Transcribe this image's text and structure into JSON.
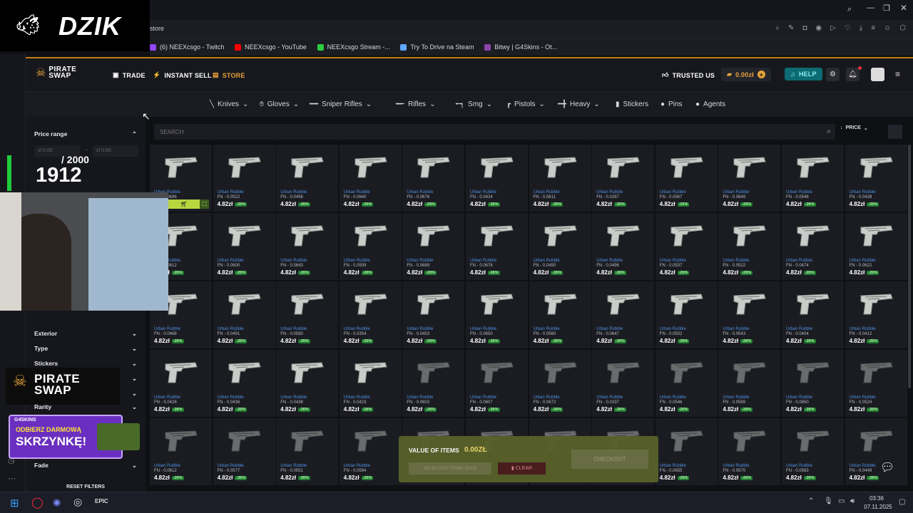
{
  "overlay": {
    "stream_logo": "DZIK",
    "counter_top": "/ 2000",
    "counter_value": "1912",
    "promo_logo_line1": "PIRATE",
    "promo_logo_line2": "SWAP",
    "promo_brand": "G4SKINS",
    "promo_text_top": "ODBIERZ DARMOWĄ",
    "promo_text_bottom": "SKRZYNKĘ!"
  },
  "browser": {
    "address_text": "store",
    "bookmarks": [
      {
        "label": "(6) NEEXcsgo - Twitch",
        "color": "#9146ff"
      },
      {
        "label": "NEEXcsgo - YouTube",
        "color": "#ff0000"
      },
      {
        "label": "NEEXcsgo Stream -...",
        "color": "#2ecc40"
      },
      {
        "label": "Try To Drive na Steam",
        "color": "#5fa8ff"
      },
      {
        "label": "Bitwy | G4Skins - Ot...",
        "color": "#8e44ad"
      }
    ]
  },
  "app": {
    "logo_line1": "PIRATE",
    "logo_line2": "SWAP",
    "nav": [
      "TRADE",
      "INSTANT SELL",
      "STORE"
    ],
    "active_nav": "STORE",
    "trusted": "TRUSTED US",
    "balance": "0.00zł",
    "help": "HELP",
    "accent": "#e8a33b"
  },
  "categories": [
    "Knives",
    "Gloves",
    "Sniper Rifles",
    "Rifles",
    "Smg",
    "Pistols",
    "Heavy",
    "Stickers",
    "Pins",
    "Agents"
  ],
  "filters": {
    "price_range": "Price range",
    "min_placeholder": "0.00",
    "max_placeholder": "0.00",
    "currency": "zł",
    "separator": "-",
    "sections": [
      "Exterior",
      "Type",
      "Stickers",
      "Rarity",
      "Fade"
    ],
    "reset": "RESET FILTERS"
  },
  "search": {
    "placeholder": "SEARCH",
    "sort": "PRICE"
  },
  "items": {
    "name": "Urban Rubble",
    "price": "4.82zł",
    "discount": "-26%",
    "fn_values": [
      "FN - 0.0696",
      "FN - 0.0522",
      "FN - 0.0458",
      "FN - 0.0640",
      "FN - 0.0678",
      "FN - 0.0424",
      "FN - 0.0611",
      "FN - 0.0267",
      "FN - 0.0567",
      "FN - 0.0649",
      "FN - 0.0546",
      "FN - 0.0439",
      "FN - 0.0612",
      "FN - 0.0600",
      "FN - 0.0643",
      "FN - 0.0509",
      "FN - 0.0689",
      "FN - 0.0676",
      "FN - 0.0450",
      "FN - 0.0496",
      "FN - 0.0537",
      "FN - 0.0522",
      "FN - 0.0474",
      "FN - 0.0622",
      "FN - 0.0468",
      "FN - 0.0491",
      "FN - 0.0580",
      "FN - 0.0354",
      "FN - 0.0453",
      "FN - 0.0650",
      "FN - 0.0560",
      "FN - 0.0647",
      "FN - 0.0502",
      "FN - 0.0543",
      "FN - 0.0404",
      "FN - 0.0412",
      "FN - 0.0428",
      "FN - 0.0436",
      "FN - 0.0438",
      "FN - 0.0423",
      "FN - 0.0603",
      "FN - 0.0607",
      "FN - 0.0672",
      "FN - 0.0337",
      "FN - 0.0546",
      "FN - 0.0589",
      "FN - 0.0650",
      "FN - 0.0524",
      "FN - 0.0612",
      "FN - 0.0577",
      "FN - 0.0551",
      "FN - 0.0594",
      "",
      "",
      "",
      "",
      "FN - 0.0655",
      "FN - 0.0570",
      "FN - 0.0583",
      "FN - 0.0449"
    ]
  },
  "checkout": {
    "value_label": "VALUE OF ITEMS",
    "value": "0.00ZŁ",
    "selected": "SELECTED ITEMS (0/15)",
    "clear": "CLEAR",
    "checkout": "CHECKOUT"
  },
  "taskbar": {
    "time": "03:36",
    "date": "07.11.2025"
  }
}
